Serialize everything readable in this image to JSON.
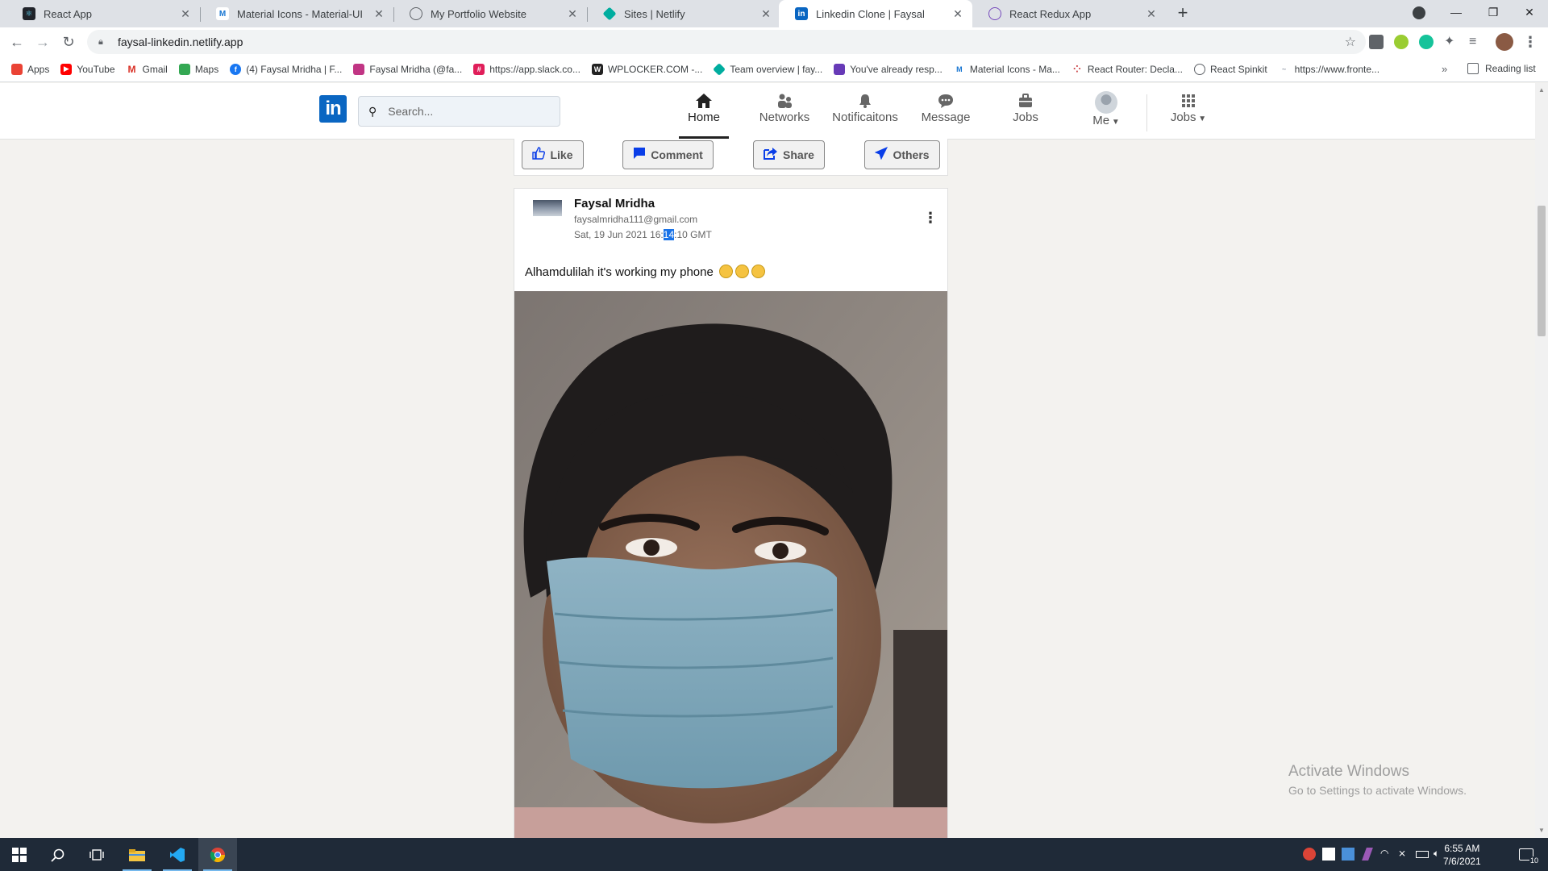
{
  "browser": {
    "tabs": [
      {
        "title": "React App",
        "icon": "react-icon",
        "color": "#20232a"
      },
      {
        "title": "Material Icons - Material-UI",
        "icon": "material-ui-icon",
        "color": "#1976d2"
      },
      {
        "title": "My Portfolio Website",
        "icon": "globe-icon",
        "color": "#5f6368"
      },
      {
        "title": "Sites | Netlify",
        "icon": "netlify-icon",
        "color": "#00ad9f"
      },
      {
        "title": "Linkedin Clone | Faysal",
        "icon": "linkedin-icon",
        "color": "#0a66c2",
        "active": true
      },
      {
        "title": "React Redux App",
        "icon": "redux-icon",
        "color": "#764abc"
      }
    ],
    "url": "faysal-linkedin.netlify.app",
    "bookmarks": [
      {
        "label": "Apps",
        "icon": "apps-grid-icon",
        "color": "#ea4335"
      },
      {
        "label": "YouTube",
        "icon": "youtube-icon",
        "color": "#ff0000"
      },
      {
        "label": "Gmail",
        "icon": "gmail-icon",
        "color": "#d93025"
      },
      {
        "label": "Maps",
        "icon": "maps-icon",
        "color": "#34a853"
      },
      {
        "label": "(4) Faysal Mridha | F...",
        "icon": "facebook-icon",
        "color": "#1877f2"
      },
      {
        "label": "Faysal Mridha (@fa...",
        "icon": "instagram-icon",
        "color": "#c13584"
      },
      {
        "label": "https://app.slack.co...",
        "icon": "slack-icon",
        "color": "#4a154b"
      },
      {
        "label": "WPLOCKER.COM -...",
        "icon": "wplocker-icon",
        "color": "#222222"
      },
      {
        "label": "Team overview | fay...",
        "icon": "netlify-icon",
        "color": "#00ad9f"
      },
      {
        "label": "You've already resp...",
        "icon": "forms-icon",
        "color": "#673ab7"
      },
      {
        "label": "Material Icons - Ma...",
        "icon": "material-ui-icon",
        "color": "#1976d2"
      },
      {
        "label": "React Router: Decla...",
        "icon": "react-router-icon",
        "color": "#ca4245"
      },
      {
        "label": "React Spinkit",
        "icon": "globe-icon",
        "color": "#5f6368"
      },
      {
        "label": "https://www.fronte...",
        "icon": "frontend-icon",
        "color": "#9ca3af"
      }
    ],
    "more_label": "»",
    "reading_list_label": "Reading list"
  },
  "linkedin": {
    "logo_text": "in",
    "search_placeholder": "Search...",
    "nav": [
      {
        "label": "Home",
        "icon": "home-icon",
        "active": true
      },
      {
        "label": "Networks",
        "icon": "people-icon"
      },
      {
        "label": "Notificaitons",
        "icon": "bell-icon"
      },
      {
        "label": "Message",
        "icon": "chat-icon"
      },
      {
        "label": "Jobs",
        "icon": "briefcase-icon"
      },
      {
        "label": "Me",
        "icon": "avatar",
        "dropdown": true
      },
      {
        "label": "Jobs",
        "icon": "apps-grid-icon",
        "dropdown": true
      }
    ]
  },
  "actions": [
    {
      "label": "Like",
      "icon": "thumb-up-icon"
    },
    {
      "label": "Comment",
      "icon": "comment-icon"
    },
    {
      "label": "Share",
      "icon": "share-icon"
    },
    {
      "label": "Others",
      "icon": "send-icon"
    }
  ],
  "post": {
    "author": "Faysal Mridha",
    "email": "faysalmridha111@gmail.com",
    "time_prefix": "Sat, 19 Jun 2021 16:",
    "time_selected": "14",
    "time_suffix": ":10 GMT",
    "text": "Alhamdulilah it's working my phone",
    "emoji_count": 3,
    "photo": "selfie-with-face-mask"
  },
  "watermark": {
    "line1": "Activate Windows",
    "line2": "Go to Settings to activate Windows."
  },
  "taskbar": {
    "time": "6:55 AM",
    "date": "7/6/2021",
    "notifications": "10"
  }
}
